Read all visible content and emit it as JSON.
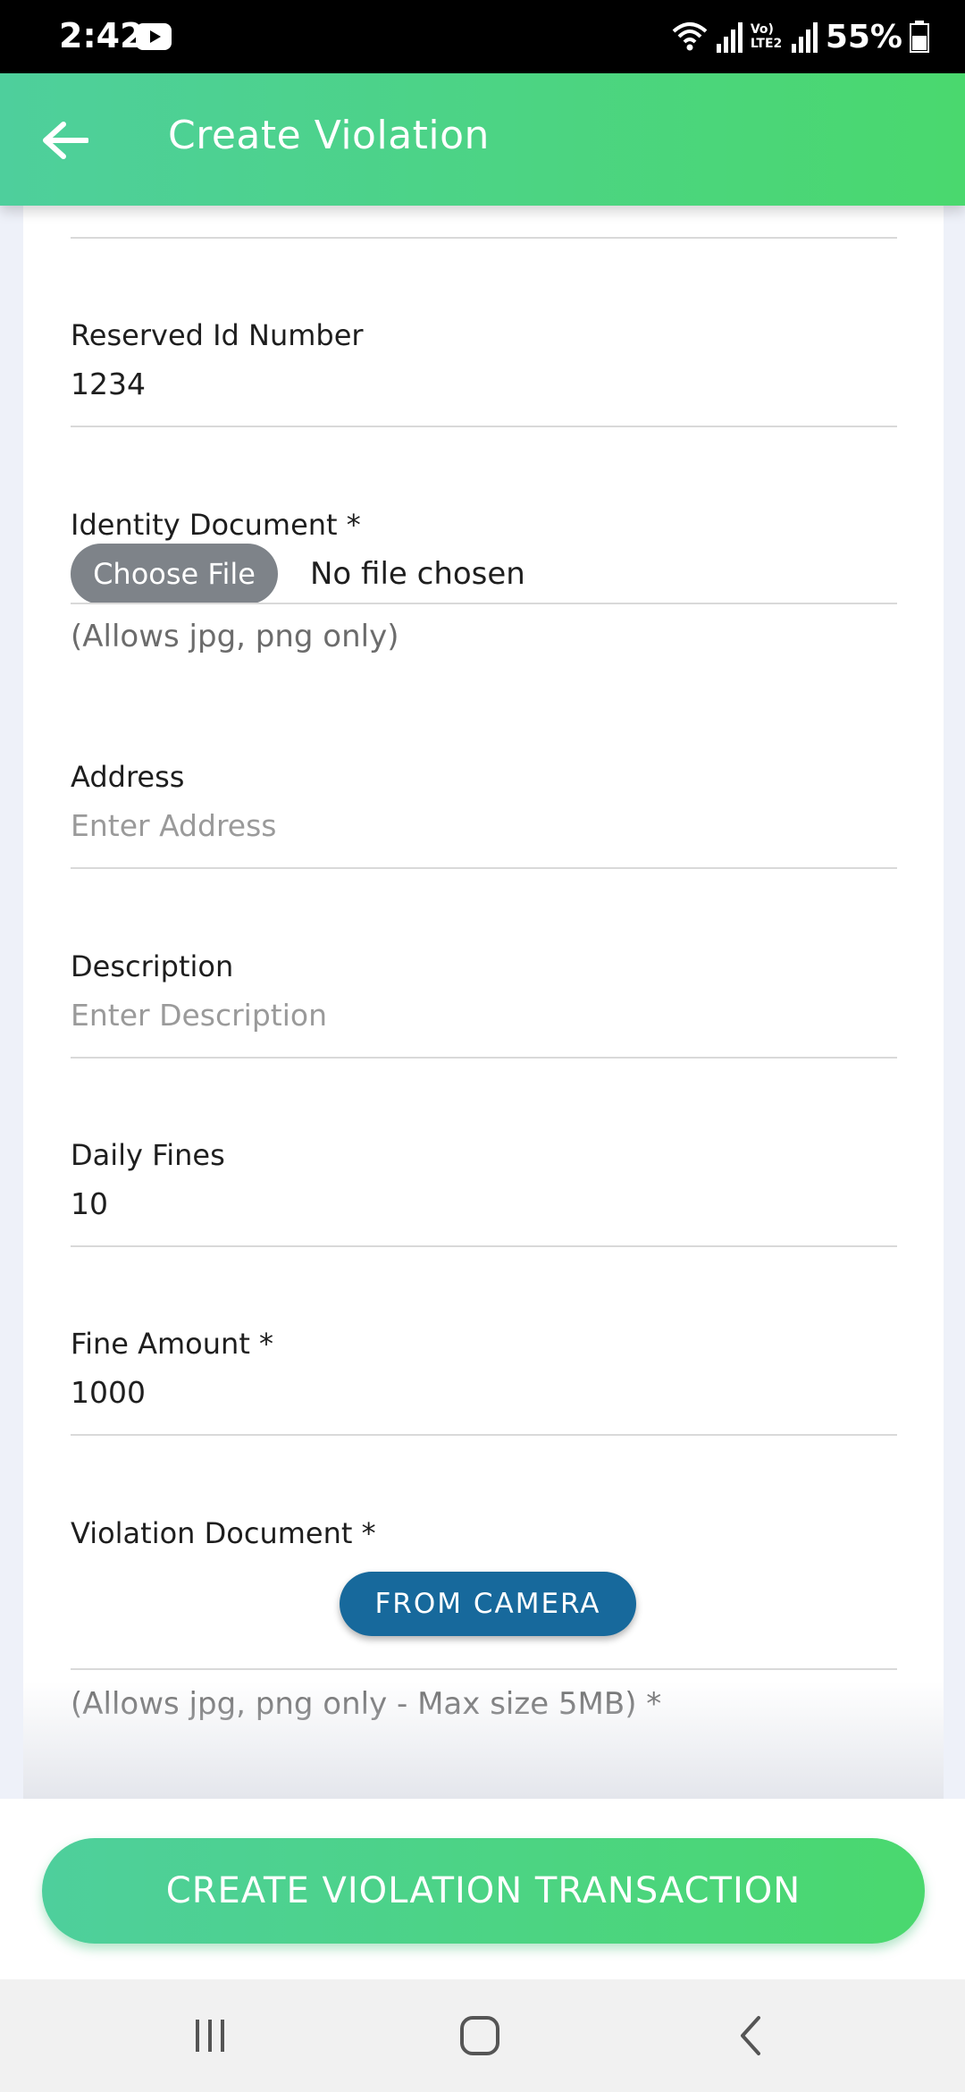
{
  "status_bar": {
    "time": "2:42",
    "battery": "55%",
    "network_label": "Vo) LTE2"
  },
  "app_bar": {
    "title": "Create Violation"
  },
  "form": {
    "reserved_id": {
      "label": "Reserved Id Number",
      "value": "1234"
    },
    "identity_document": {
      "label": "Identity Document *",
      "button_label": "Choose File",
      "file_status": "No file chosen",
      "hint": "(Allows jpg, png only)"
    },
    "address": {
      "label": "Address",
      "placeholder": "Enter Address"
    },
    "description": {
      "label": "Description",
      "placeholder": "Enter Description"
    },
    "daily_fines": {
      "label": "Daily Fines",
      "value": "10"
    },
    "fine_amount": {
      "label": "Fine Amount *",
      "value": "1000"
    },
    "violation_document": {
      "label": "Violation Document *",
      "button_label": "FROM CAMERA",
      "hint": "(Allows jpg, png only - Max size 5MB) *"
    }
  },
  "actions": {
    "submit_label": "CREATE VIOLATION TRANSACTION"
  },
  "colors": {
    "accent_start": "#4ecf9c",
    "accent_end": "#4ad86e",
    "camera_button": "#17699c",
    "choose_file_button": "#7e8389"
  },
  "icons": {
    "back": "arrow-left-icon",
    "youtube": "youtube-icon",
    "wifi": "wifi-icon",
    "signal": "signal-icon",
    "battery": "battery-icon",
    "recents": "recents-icon",
    "home": "home-icon",
    "nav_back": "chevron-left-icon"
  }
}
